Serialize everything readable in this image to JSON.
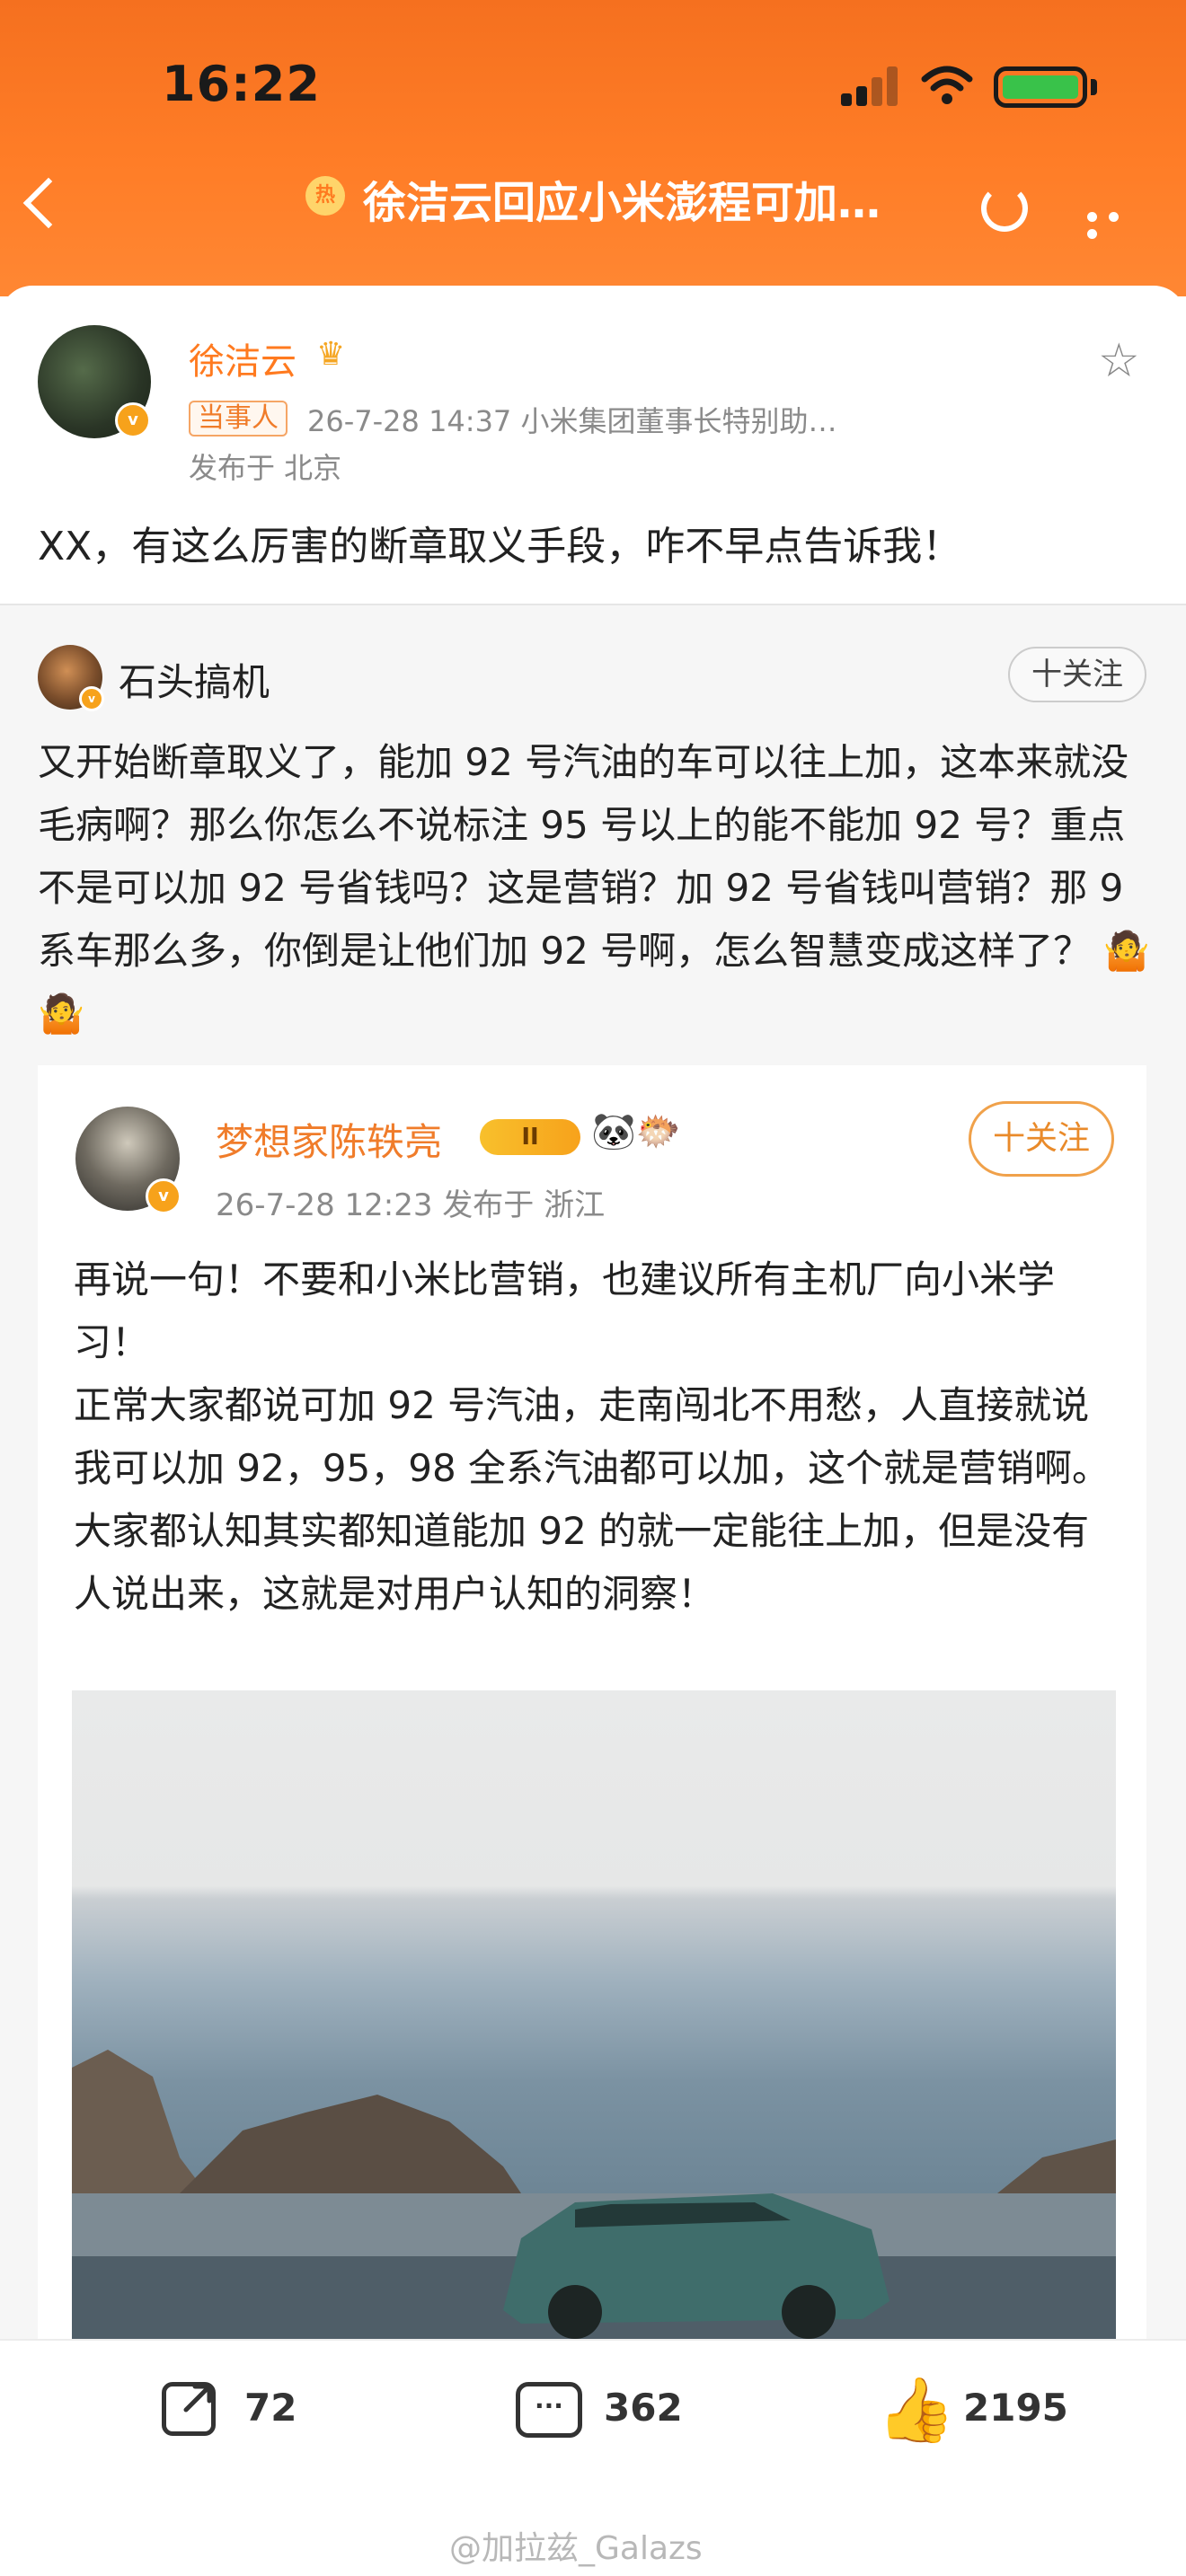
{
  "status_bar": {
    "time": "16:22"
  },
  "nav": {
    "topic_title": "徐洁云回应小米澎程可加…",
    "hot_label": "热"
  },
  "post": {
    "author": "徐洁云",
    "badge": "当事人",
    "meta": "26-7-28 14:37  小米集团董事长特别助…",
    "location": "发布于 北京",
    "text": "XX，有这么厉害的断章取义手段，咋不早点告诉我！"
  },
  "repost": {
    "author": "石头搞机",
    "follow_label": "十关注",
    "text": "又开始断章取义了，能加 92 号汽油的车可以往上加，这本来就没毛病啊？那么你怎么不说标注 95 号以上的能不能加 92 号？重点不是可以加 92 号省钱吗？这是营销？加 92 号省钱叫营销？那 9 系车那么多，你倒是让他们加 92 号啊，怎么智慧变成这样了？",
    "emoji": "🤷🤷"
  },
  "embedded": {
    "author": "梦想家陈轶亮",
    "level_label": "II",
    "emoji": "🐼🐡",
    "follow_label": "十关注",
    "meta": "26-7-28 12:23  发布于 浙江",
    "lines": [
      "再说一句！不要和小米比营销，也建议所有主机厂向小米学习！",
      "正常大家都说可加 92 号汽油，走南闯北不用愁，人直接就说我可以加 92，95，98 全系汽油都可以加，这个就是营销啊。",
      "大家都认知其实都知道能加 92 的就一定能往上加，但是没有人说出来，这就是对用户认知的洞察！"
    ]
  },
  "actions": {
    "shares": "72",
    "comments": "362",
    "likes": "2195"
  },
  "watermark": "@加拉兹_Galazs",
  "colors": {
    "header": "#ff7d27",
    "accent": "#ff7a1f",
    "follow": "#e98a2a"
  },
  "icons": [
    "back-icon",
    "refresh-icon",
    "more-icon",
    "star-icon",
    "share-icon",
    "comment-icon",
    "like-icon",
    "verified-icon",
    "crown-icon"
  ]
}
